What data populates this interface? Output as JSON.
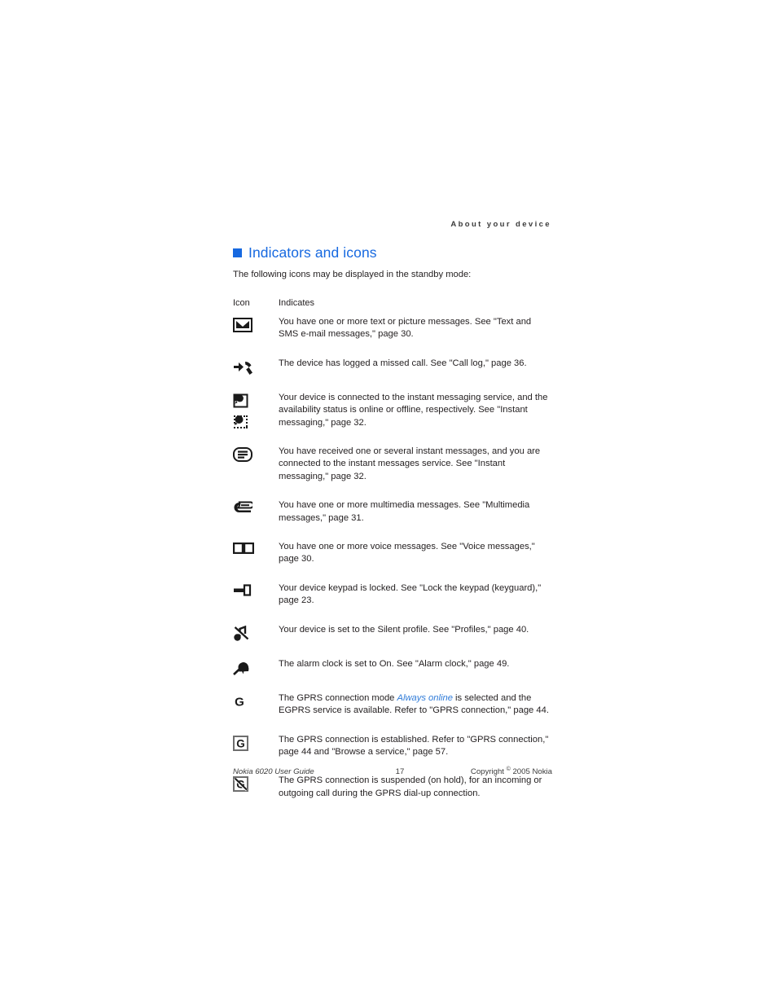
{
  "header": {
    "running_head": "About your device"
  },
  "section": {
    "title": "Indicators and icons",
    "bullet_color": "#1769e0",
    "intro": "The following icons may be displayed in the standby mode:"
  },
  "table": {
    "columns": [
      "Icon",
      "Indicates"
    ],
    "rows": [
      {
        "icon": "envelope-icon",
        "text_parts": [
          {
            "t": "You have one or more text or picture messages. See \"Text and SMS e-mail messages,\" page 30.",
            "style": "normal"
          }
        ]
      },
      {
        "icon": "missed-call-icon",
        "text_parts": [
          {
            "t": "The device has logged a missed call. See \"Call log,\" page 36.",
            "style": "normal"
          }
        ]
      },
      {
        "icon": "im-presence-online-offline-icon",
        "text_parts": [
          {
            "t": "Your device is connected to the instant messaging service, and the availability status is online or offline, respectively. See \"Instant messaging,\" page 32.",
            "style": "normal"
          }
        ]
      },
      {
        "icon": "instant-message-received-icon",
        "text_parts": [
          {
            "t": "You have received one or several instant messages, and you are connected to the instant messages service. See \"Instant messaging,\" page 32.",
            "style": "normal"
          }
        ]
      },
      {
        "icon": "multimedia-message-icon",
        "text_parts": [
          {
            "t": "You have one or more multimedia messages. See \"Multimedia messages,\" page 31.",
            "style": "normal"
          }
        ]
      },
      {
        "icon": "voice-message-icon",
        "text_parts": [
          {
            "t": "You have one or more voice messages. See \"Voice messages,\" page 30.",
            "style": "normal"
          }
        ]
      },
      {
        "icon": "keypad-lock-key-icon",
        "text_parts": [
          {
            "t": "Your device keypad is locked. See \"Lock the keypad (keyguard),\" page 23.",
            "style": "normal"
          }
        ]
      },
      {
        "icon": "silent-profile-icon",
        "text_parts": [
          {
            "t": "Your device is set to the Silent profile. See \"Profiles,\" page 40.",
            "style": "normal"
          }
        ]
      },
      {
        "icon": "alarm-clock-bell-icon",
        "text_parts": [
          {
            "t": "The alarm clock is set to On. See \"Alarm clock,\" page 49.",
            "style": "normal"
          }
        ]
      },
      {
        "icon": "gprs-egprs-available-icon",
        "text_parts": [
          {
            "t": "The GPRS connection mode ",
            "style": "normal"
          },
          {
            "t": "Always online",
            "style": "emph"
          },
          {
            "t": " is selected and the EGPRS service is available. Refer to \"GPRS connection,\" page 44.",
            "style": "normal"
          }
        ]
      },
      {
        "icon": "gprs-connection-established-icon",
        "text_parts": [
          {
            "t": "The GPRS connection is established. Refer to \"GPRS connection,\" page 44 and \"Browse a service,\" page 57.",
            "style": "normal"
          }
        ]
      },
      {
        "icon": "gprs-connection-suspended-icon",
        "text_parts": [
          {
            "t": "The GPRS connection is suspended (on hold), for an incoming or outgoing call during the GPRS dial-up connection.",
            "style": "normal"
          }
        ]
      }
    ]
  },
  "footer": {
    "left": "Nokia 6020 User Guide",
    "page_number": "17",
    "copyright_prefix": "Copyright ",
    "copyright_symbol": "©",
    "copyright_suffix": " 2005 Nokia"
  }
}
